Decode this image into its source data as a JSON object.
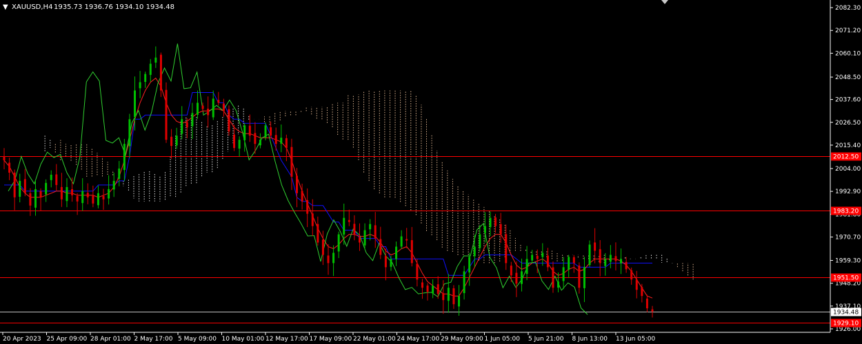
{
  "header": {
    "menu_glyph": "▼",
    "symbol": "XAUUSD,H4",
    "ohlc": "1935.73 1936.76 1934.10 1934.48"
  },
  "colors": {
    "background": "#000000",
    "axis": "#ffffff",
    "bull_candle": "#00c000",
    "bear_candle": "#e00000",
    "tenkan": "#ff2020",
    "kijun": "#1010ff",
    "chikou": "#30d030",
    "cloud_a": "#ffffff",
    "cloud_b": "#f5c8a0",
    "level_line": "#ff0000",
    "price_line": "#c8c8c8"
  },
  "chart_data": {
    "type": "candlestick",
    "indicator": "ichimoku",
    "ylim": [
      1926.0,
      2084.0
    ],
    "y_ticks": [
      "2082.30",
      "2071.20",
      "2060.10",
      "2048.50",
      "2037.60",
      "2026.50",
      "2015.40",
      "2004.00",
      "1992.90",
      "1981.80",
      "1970.70",
      "1959.30",
      "1948.20",
      "1937.10",
      "1926.00"
    ],
    "x_ticks": [
      "20 Apr 2023",
      "25 Apr 09:00",
      "28 Apr 01:00",
      "2 May 17:00",
      "5 May 09:00",
      "10 May 01:00",
      "12 May 17:00",
      "17 May 09:00",
      "22 May 01:00",
      "24 May 17:00",
      "29 May 09:00",
      "1 Jun 05:00",
      "5 Jun 21:00",
      "8 Jun 13:00",
      "13 Jun 05:00"
    ],
    "levels": [
      {
        "value": 2010.0,
        "label": "2012.50"
      },
      {
        "value": 1983.5,
        "label": "1983.20"
      },
      {
        "value": 1951.2,
        "label": "1951.50"
      },
      {
        "value": 1929.1,
        "label": "1929.10"
      }
    ],
    "current_price": {
      "value": 1934.48,
      "label": "1934.48"
    },
    "close_path": [
      2008,
      2002,
      1990,
      1998,
      1992,
      1986,
      1994,
      1990,
      1997,
      2001,
      1996,
      1989,
      1995,
      1991,
      1988,
      1993,
      1990,
      1987,
      1992,
      1989,
      1994,
      1998,
      2004,
      2016,
      2028,
      2042,
      2046,
      2050,
      2055,
      2058,
      2042,
      2018,
      2015,
      2020,
      2028,
      2024,
      2031,
      2036,
      2033,
      2030,
      2038,
      2036,
      2032,
      2022,
      2014,
      2018,
      2025,
      2020,
      2016,
      2018,
      2025,
      2020,
      2016,
      2019,
      2014,
      2000,
      1992,
      1988,
      1982,
      1976,
      1968,
      1962,
      1958,
      1963,
      1972,
      1980,
      1978,
      1972,
      1968,
      1974,
      1977,
      1970,
      1962,
      1956,
      1960,
      1966,
      1971,
      1969,
      1958,
      1950,
      1946,
      1944,
      1947,
      1943,
      1940,
      1946,
      1938,
      1942,
      1954,
      1961,
      1966,
      1972,
      1976,
      1980,
      1976,
      1972,
      1958,
      1952,
      1948,
      1954,
      1960,
      1962,
      1960,
      1963,
      1956,
      1946,
      1949,
      1956,
      1961,
      1958,
      1946,
      1956,
      1967,
      1964,
      1958,
      1960,
      1962,
      1959,
      1960,
      1955,
      1950,
      1945,
      1942,
      1936,
      1934.48
    ],
    "tenkan_path": [
      2008,
      2005,
      2000,
      1995,
      1992,
      1990,
      1990,
      1990,
      1991,
      1992,
      1993,
      1993,
      1992,
      1992,
      1991,
      1991,
      1991,
      1991,
      1990,
      1991,
      1992,
      1995,
      2000,
      2008,
      2018,
      2028,
      2036,
      2042,
      2046,
      2048,
      2044,
      2036,
      2030,
      2027,
      2026,
      2027,
      2029,
      2031,
      2032,
      2032,
      2033,
      2033,
      2032,
      2028,
      2024,
      2022,
      2021,
      2021,
      2020,
      2019,
      2019,
      2019,
      2018,
      2017,
      2014,
      2008,
      2000,
      1993,
      1987,
      1981,
      1975,
      1970,
      1966,
      1965,
      1967,
      1970,
      1972,
      1972,
      1971,
      1971,
      1972,
      1971,
      1968,
      1964,
      1962,
      1963,
      1965,
      1966,
      1963,
      1958,
      1953,
      1949,
      1947,
      1945,
      1943,
      1943,
      1942,
      1942,
      1946,
      1951,
      1956,
      1961,
      1966,
      1970,
      1972,
      1972,
      1968,
      1962,
      1957,
      1955,
      1956,
      1958,
      1959,
      1960,
      1958,
      1954,
      1952,
      1953,
      1955,
      1956,
      1954,
      1955,
      1958,
      1960,
      1960,
      1960,
      1960,
      1960,
      1959,
      1957,
      1954,
      1950,
      1946,
      1942,
      1941
    ],
    "kijun_path": [
      1996,
      1996,
      1996,
      1996,
      1993,
      1993,
      1993,
      1993,
      1993,
      1993,
      1993,
      1993,
      1993,
      1993,
      1993,
      1993,
      1993,
      1993,
      1996,
      1996,
      1996,
      1996,
      1998,
      1998,
      2010,
      2028,
      2028,
      2030,
      2030,
      2030,
      2030,
      2030,
      2030,
      2030,
      2030,
      2030,
      2041,
      2041,
      2041,
      2041,
      2041,
      2036,
      2036,
      2030,
      2028,
      2028,
      2026,
      2026,
      2026,
      2026,
      2026,
      2020,
      2014,
      2008,
      2004,
      2000,
      1990,
      1988,
      1988,
      1986,
      1986,
      1986,
      1982,
      1978,
      1978,
      1974,
      1974,
      1974,
      1970,
      1970,
      1970,
      1970,
      1966,
      1966,
      1960,
      1960,
      1960,
      1960,
      1960,
      1960,
      1960,
      1960,
      1960,
      1960,
      1960,
      1952,
      1952,
      1952,
      1952,
      1956,
      1960,
      1960,
      1962,
      1962,
      1962,
      1962,
      1962,
      1962,
      1960,
      1958,
      1958,
      1958,
      1958,
      1958,
      1958,
      1958,
      1958,
      1958,
      1958,
      1958,
      1956,
      1956,
      1956,
      1956,
      1956,
      1956,
      1958,
      1958,
      1958,
      1958,
      1958,
      1958,
      1958,
      1958,
      1958
    ],
    "chikou_path": [
      1993,
      1993,
      2012,
      2008,
      2000,
      1996,
      2003,
      2012,
      2012,
      2009,
      2012,
      2005,
      1998,
      1996,
      2010,
      2045,
      2050,
      2052,
      2045,
      2018,
      2012,
      2026,
      2014,
      2010,
      2025,
      2035,
      2028,
      2020,
      2032,
      2044,
      2052,
      2054,
      2044,
      2065,
      2044,
      2040,
      2046,
      2052,
      2030,
      2030,
      2036,
      2034,
      2032,
      2038,
      2034,
      2030,
      2018,
      2008,
      2010,
      2022,
      2016,
      2022,
      2008,
      1998,
      1992,
      1986,
      1982,
      1978,
      1972,
      1970,
      1972,
      1958,
      1970,
      1980,
      1978,
      1972,
      1966,
      1974,
      1976,
      1968,
      1962,
      1958,
      1970,
      1964,
      1960,
      1958,
      1952,
      1946,
      1944,
      1947,
      1943,
      1942,
      1948,
      1940,
      1942,
      1948,
      1946,
      1954,
      1958,
      1962,
      1960,
      1970,
      1980,
      1976,
      1960,
      1958,
      1948,
      1944,
      1954,
      1946,
      1949,
      1954,
      1961,
      1958,
      1950,
      1944,
      1947,
      1954,
      1944,
      1948,
      1950,
      1942,
      1934,
      1933
    ],
    "cloud_a_path": [
      2020,
      2018,
      2012,
      2008,
      2010,
      2008,
      2006,
      2004,
      2000,
      2000,
      2001,
      2000,
      2001,
      2001,
      2000,
      1998,
      1998,
      2000,
      2001,
      2002,
      2003,
      2002,
      2000,
      2000,
      2006,
      2016,
      2026,
      2028,
      2030,
      2030,
      2028,
      2025,
      2024,
      2026,
      2028,
      2030,
      2032,
      2034,
      2035,
      2032,
      2028,
      2028,
      2028,
      2026,
      2025,
      2026,
      2028,
      2030,
      2030,
      2030,
      2032,
      2032,
      2030,
      2028,
      2028,
      2026,
      2024,
      2020,
      2018,
      2018,
      2014,
      2008,
      2002,
      1998,
      1994,
      1992,
      1990,
      1990,
      1990,
      1988,
      1986,
      1984,
      1982,
      1978,
      1974,
      1972,
      1970,
      1966,
      1964,
      1964,
      1962,
      1962,
      1962,
      1962,
      1960,
      1958,
      1958,
      1958,
      1958,
      1960,
      1962,
      1964,
      1964,
      1964,
      1964,
      1962,
      1962,
      1962,
      1960,
      1960,
      1958,
      1960,
      1962,
      1962,
      1960,
      1960,
      1960,
      1960,
      1958,
      1958,
      1960,
      1960,
      1960,
      1961,
      1960,
      1960,
      1961,
      1962,
      1962,
      1962,
      1962,
      1960,
      1958,
      1956,
      1954,
      1952,
      1950
    ],
    "cloud_b_path": [
      2012,
      2014,
      2016,
      2018,
      2016,
      2016,
      2016,
      2016,
      2016,
      2014,
      2012,
      2010,
      2008,
      2004,
      2000,
      1996,
      1994,
      1990,
      1988,
      1988,
      1988,
      1988,
      1988,
      1988,
      1990,
      1990,
      1990,
      1994,
      1996,
      1996,
      1998,
      2002,
      2002,
      2002,
      2006,
      2010,
      2014,
      2018,
      2022,
      2026,
      2028,
      2028,
      2028,
      2030,
      2030,
      2032,
      2032,
      2032,
      2032,
      2032,
      2032,
      2034,
      2034,
      2034,
      2034,
      2034,
      2036,
      2036,
      2036,
      2040,
      2040,
      2040,
      2042,
      2042,
      2042,
      2042,
      2042,
      2042,
      2042,
      2042,
      2042,
      2042,
      2040,
      2036,
      2030,
      2022,
      2014,
      2008,
      2004,
      2000,
      1996,
      1994,
      1992,
      1990,
      1988,
      1986,
      1984,
      1982,
      1980,
      1978,
      1976,
      1972,
      1968,
      1966,
      1964,
      1964,
      1964,
      1964,
      1964,
      1964,
      1962,
      1962,
      1962,
      1962,
      1962,
      1962,
      1962,
      1962,
      1962,
      1962,
      1960,
      1960,
      1960,
      1960,
      1960,
      1960,
      1960,
      1960,
      1960,
      1960,
      1958,
      1958,
      1958,
      1958,
      1958,
      1958,
      1958
    ]
  }
}
